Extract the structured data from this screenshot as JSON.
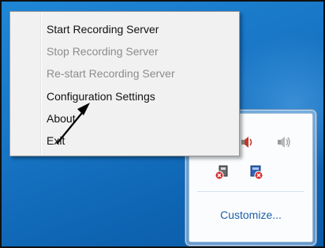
{
  "desktop": {
    "background_color": "#1a79c9"
  },
  "context_menu": {
    "items": [
      {
        "label": "Start Recording Server",
        "enabled": true
      },
      {
        "label": "Stop Recording Server",
        "enabled": false
      },
      {
        "label": "Re-start Recording Server",
        "enabled": false
      },
      {
        "label": "Configuration Settings",
        "enabled": true
      },
      {
        "label": "About",
        "enabled": true
      },
      {
        "label": "Exit",
        "enabled": true
      }
    ]
  },
  "tray_flyout": {
    "icons": [
      {
        "name": "speaker-muted-icon"
      },
      {
        "name": "speaker-icon"
      },
      {
        "name": "recording-server-stopped-icon"
      },
      {
        "name": "recording-server-alert-icon"
      }
    ],
    "customize_label": "Customize..."
  }
}
